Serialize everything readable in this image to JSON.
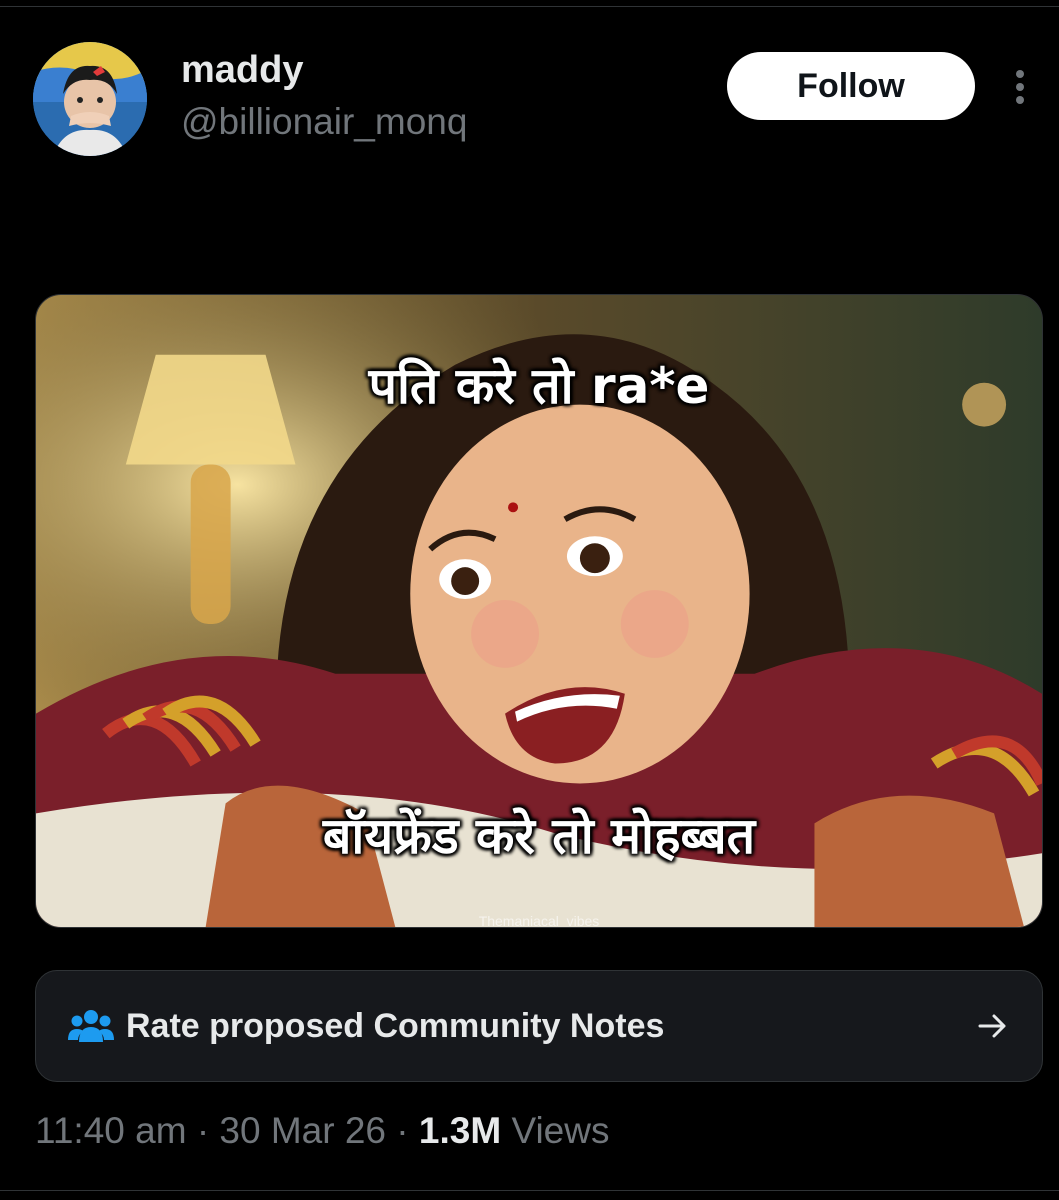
{
  "author": {
    "name": "maddy",
    "handle": "@billionair_monq"
  },
  "actions": {
    "follow_label": "Follow"
  },
  "media": {
    "caption_top": "पति करे तो ra*e",
    "caption_bottom": "बॉयफ्रेंड करे तो मोहब्बत",
    "watermark": "Themaniacal_vibes"
  },
  "community_notes": {
    "label": "Rate proposed Community Notes",
    "icon": "people-icon",
    "arrow_icon": "arrow-right-icon"
  },
  "meta": {
    "time": "11:40 am",
    "separator": "·",
    "date": "30 Mar 26",
    "views_count": "1.3M",
    "views_label": "Views"
  },
  "colors": {
    "background": "#000000",
    "primary_text": "#e7e9ea",
    "secondary_text": "#71767b",
    "notes_icon": "#1d9bf0",
    "follow_bg": "#ffffff"
  }
}
